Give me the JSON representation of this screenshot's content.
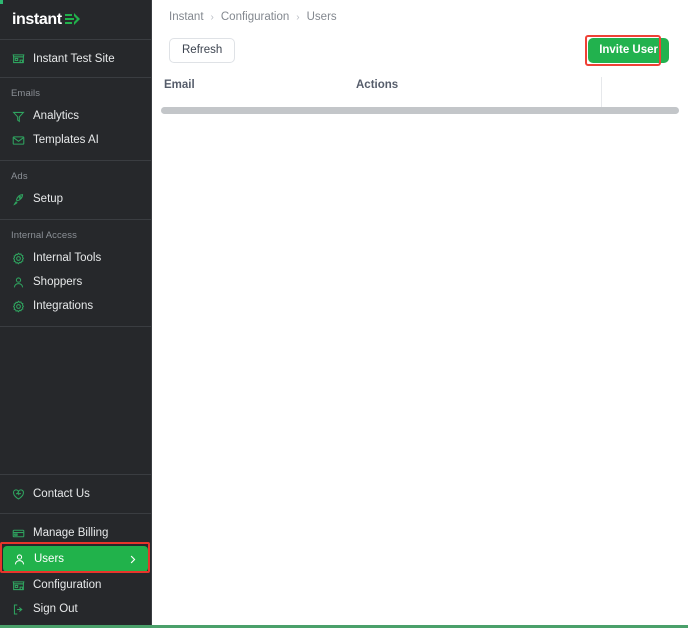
{
  "brand": {
    "logo_text": "instant",
    "logo_mark": "arrow-logo-icon",
    "accent_green": "#21b24b",
    "sidebar_bg": "#26282b",
    "annotation_red": "#e8352b"
  },
  "sidebar": {
    "site": {
      "label": "Instant Test Site",
      "icon": "store-icon"
    },
    "sections": [
      {
        "title": "Emails",
        "items": [
          {
            "label": "Analytics",
            "icon": "funnel-icon"
          },
          {
            "label": "Templates AI",
            "icon": "mail-icon"
          }
        ]
      },
      {
        "title": "Ads",
        "items": [
          {
            "label": "Setup",
            "icon": "rocket-icon"
          }
        ]
      },
      {
        "title": "Internal Access",
        "items": [
          {
            "label": "Internal Tools",
            "icon": "gear-icon"
          },
          {
            "label": "Shoppers",
            "icon": "user-icon"
          },
          {
            "label": "Integrations",
            "icon": "gear-icon"
          }
        ]
      }
    ],
    "bottom_items": [
      {
        "label": "Contact Us",
        "icon": "heart-icon",
        "active": false
      },
      {
        "label": "Manage Billing",
        "icon": "credit-card-icon",
        "active": false
      },
      {
        "label": "Users",
        "icon": "user-icon",
        "active": true,
        "chevron": "chevron-right-icon"
      },
      {
        "label": "Configuration",
        "icon": "store-icon",
        "active": false
      },
      {
        "label": "Sign Out",
        "icon": "logout-icon",
        "active": false
      }
    ]
  },
  "main": {
    "breadcrumb": [
      "Instant",
      "Configuration",
      "Users"
    ],
    "breadcrumb_separator": "›",
    "toolbar": {
      "refresh_label": "Refresh",
      "invite_label": "Invite User"
    },
    "table": {
      "columns": [
        "Email",
        "Actions"
      ],
      "rows": []
    }
  }
}
